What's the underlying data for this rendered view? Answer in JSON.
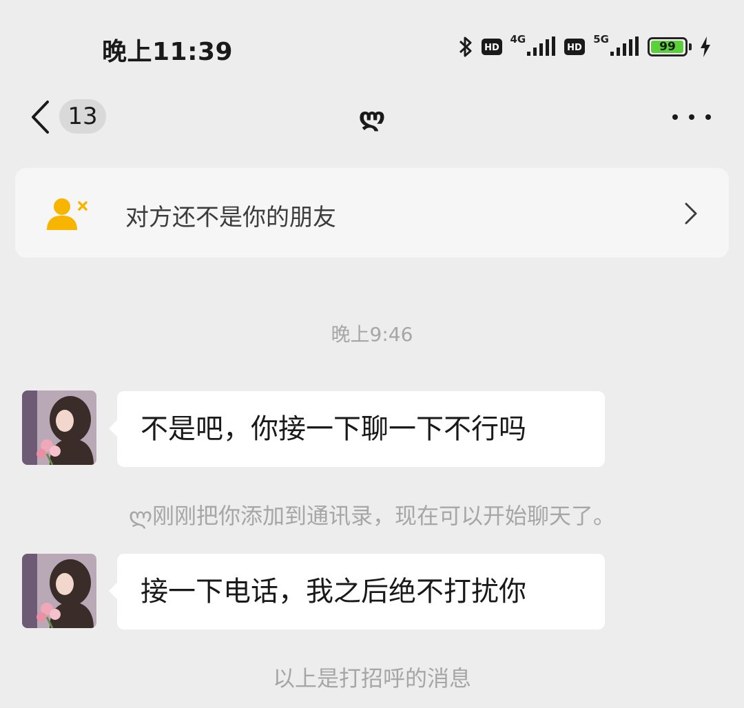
{
  "status_bar": {
    "time": "晚上11:39",
    "network_1": "4G",
    "network_2": "5G",
    "hd_label": "HD",
    "battery_level": "99",
    "battery_fraction": 0.99,
    "icons": [
      "bluetooth-icon",
      "hd-icon",
      "signal-icon",
      "hd-icon",
      "signal-icon",
      "battery-icon",
      "charging-icon"
    ]
  },
  "nav": {
    "unread_count": "13",
    "title": "ლ",
    "icons": [
      "back-chevron-icon",
      "more-icon"
    ]
  },
  "friend_banner": {
    "text": "对方还不是你的朋友",
    "icon": "user-remove-icon",
    "accent_color": "#f7b500"
  },
  "messages": {
    "time_divider": "晚上9:46",
    "message_1": "不是吧，你接一下聊一下不行吗",
    "system_name": "ლ",
    "system_text": "刚刚把你添加到通讯录，现在可以开始聊天了。",
    "message_2": "接一下电话，我之后绝不打扰你",
    "greeting_notice": "以上是打招呼的消息"
  },
  "colors": {
    "background": "#ededed",
    "bubble": "#ffffff",
    "banner": "#f6f6f6",
    "muted_text": "#a6a6a6",
    "battery_fill": "#5ad13b"
  }
}
